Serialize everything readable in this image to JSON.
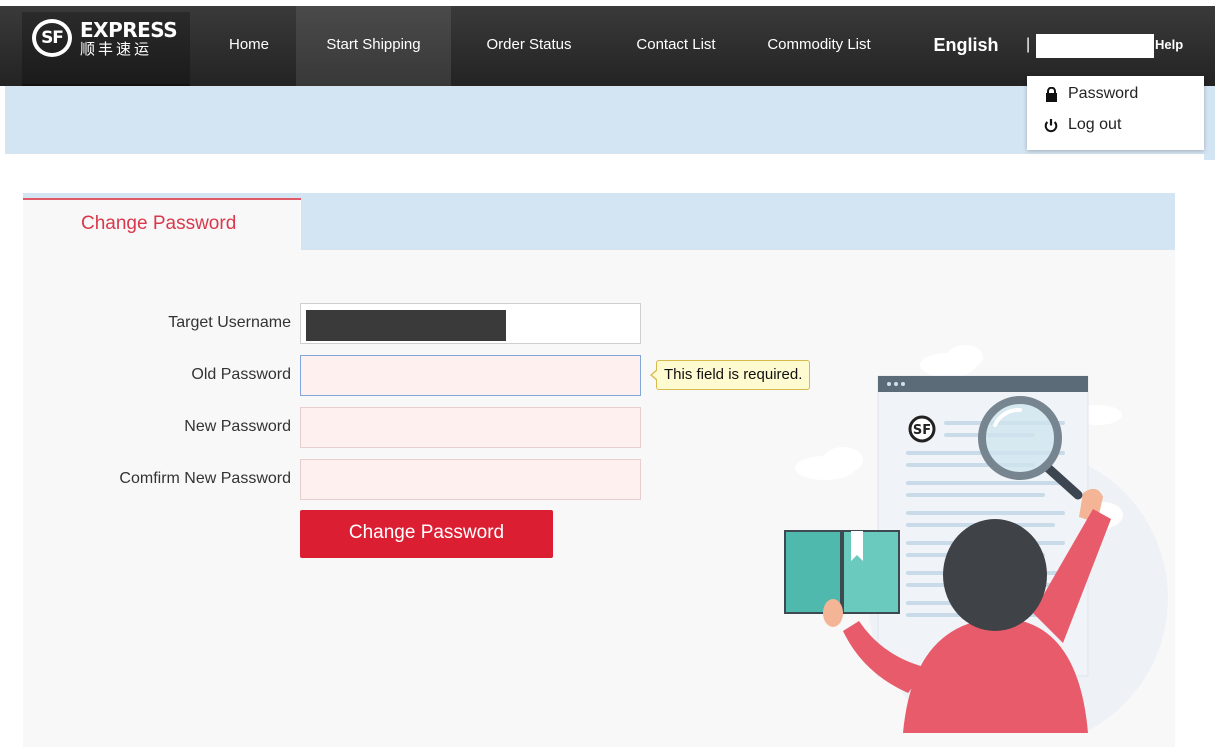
{
  "brand": {
    "logo_mark": "SF",
    "name": "EXPRESS",
    "name_cn": "顺丰速运"
  },
  "nav": {
    "items": [
      {
        "label": "Home"
      },
      {
        "label": "Start Shipping"
      },
      {
        "label": "Order Status"
      },
      {
        "label": "Contact List"
      },
      {
        "label": "Commodity List"
      }
    ],
    "active_index": 1,
    "language": "English",
    "separator": "|",
    "help": "Help"
  },
  "user_menu": {
    "items": [
      {
        "label": "Password",
        "icon": "lock-icon"
      },
      {
        "label": "Log out",
        "icon": "power-icon"
      }
    ]
  },
  "panel": {
    "tab_label": "Change Password",
    "form": {
      "target_username_label": "Target Username",
      "old_password_label": "Old Password",
      "new_password_label": "New Password",
      "confirm_password_label": "Comfirm New Password",
      "validation_message": "This field is required.",
      "submit_label": "Change Password"
    },
    "illustration_logo": "SF"
  },
  "colors": {
    "nav_bg": "#2b2b2b",
    "band_bg": "#d3e4f2",
    "accent_red": "#dc1e33",
    "tab_text": "#d9394c",
    "error_field_bg": "#fff0f0",
    "tooltip_bg": "#fffbd1"
  }
}
